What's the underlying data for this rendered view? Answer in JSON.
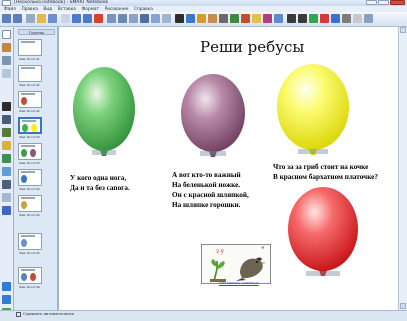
{
  "window": {
    "title": "[Несколько.notebook] - SMART Notebook"
  },
  "menu": [
    "Файл",
    "Правка",
    "Вид",
    "Вставка",
    "Формат",
    "Рисование",
    "Справка"
  ],
  "thumbs_panel": {
    "header": "Группы",
    "thumb_labels": [
      "Фев 16-12:41",
      "Фев 16-12:42",
      "Фев 16-12:42",
      "Фев 16-12:43",
      "Фев 16-12:43",
      "Фев 16-12:44",
      "Фев 16-12:44",
      "Фев 16-12:45",
      "Фев 16-12:46"
    ],
    "hide_checkbox": "Скрывать автоматически"
  },
  "slide": {
    "title": "Реши ребусы",
    "riddle1": [
      "У кого одна нога,",
      "Да и та без сапога."
    ],
    "riddle2": [
      "А вот кто-то важный",
      "На беленькой ножке.",
      "Он с красной шляпкой,",
      "На шляпке горошки."
    ],
    "riddle3": [
      "Что за за гриб стоит на кочке",
      "В красном бархатном платочке?"
    ],
    "rebus_letters": "з у",
    "rebus_quote": "\"",
    "link": "Настроить границы"
  },
  "colors": {
    "balloon_green": "#3fb24a",
    "balloon_purple": "#8a5577",
    "balloon_yellow": "#f4f21c",
    "balloon_red": "#ee1e22"
  }
}
